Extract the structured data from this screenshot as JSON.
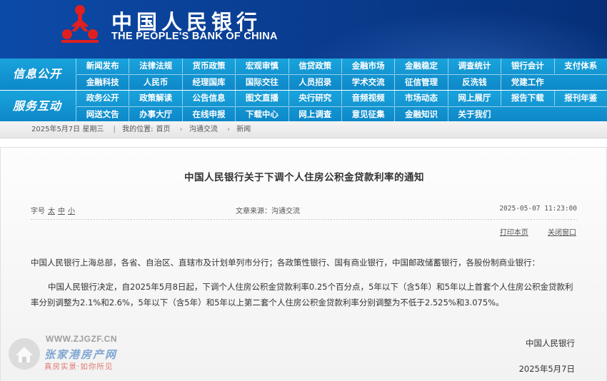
{
  "colors": {
    "header_blue": "#0a3f94",
    "nav_blue": "#1aa3dc",
    "emblem_red": "#e02020",
    "text": "#333333"
  },
  "header": {
    "title_cn": "中国人民银行",
    "title_en": "THE PEOPLE'S BANK OF CHINA",
    "emblem_icon": "pboc-emblem-icon"
  },
  "nav": {
    "group1": {
      "label": "信息公开",
      "row1": [
        "新闻发布",
        "法律法规",
        "货币政策",
        "宏观审慎",
        "信贷政策",
        "金融市场",
        "金融稳定",
        "调查统计",
        "银行会计",
        "支付体系"
      ],
      "row2": [
        "金融科技",
        "人民币",
        "经理国库",
        "国际交往",
        "人员招录",
        "学术交流",
        "征信管理",
        "反洗钱",
        "党建工作"
      ]
    },
    "group2": {
      "label": "服务互动",
      "row1": [
        "政务公开",
        "政策解读",
        "公告信息",
        "图文直播",
        "央行研究",
        "音频视频",
        "市场动态",
        "网上展厅",
        "报告下载",
        "报刊年鉴"
      ],
      "row2": [
        "网送文告",
        "办事大厅",
        "在线申报",
        "下载中心",
        "网上调查",
        "意见征集",
        "金融知识",
        "关于我们"
      ]
    }
  },
  "breadcrumb": {
    "date": "2025年5月7日 星期三",
    "location_prefix": "我的位置:",
    "items": [
      "首页",
      "沟通交流",
      "新闻"
    ]
  },
  "article": {
    "title": "中国人民银行关于下调个人住房公积金贷款利率的通知",
    "fontsize_label": "字号",
    "fontsize_options": [
      "太",
      "中",
      "小"
    ],
    "source": "文章来源：沟通交流",
    "datetime": "2025-05-07 11:23:00",
    "print_label": "打印本页",
    "close_label": "关闭窗口",
    "addressee": "中国人民银行上海总部，各省、自治区、直辖市及计划单列市分行；各政策性银行、国有商业银行，中国邮政储蓄银行，各股份制商业银行：",
    "paragraph": "中国人民银行决定，自2025年5月8日起，下调个人住房公积金贷款利率0.25个百分点，5年以下（含5年）和5年以上首套个人住房公积金贷款利率分别调整为2.1%和2.6%，5年以下（含5年）和5年以上第二套个人住房公积金贷款利率分别调整为不低于2.525%和3.075%。",
    "signature": "中国人民银行",
    "sign_date": "2025年5月7日"
  },
  "watermark": {
    "url": "WWW.ZJGZF.CN",
    "name": "张家港房产网",
    "slogan": "真房实景·如你所见"
  }
}
